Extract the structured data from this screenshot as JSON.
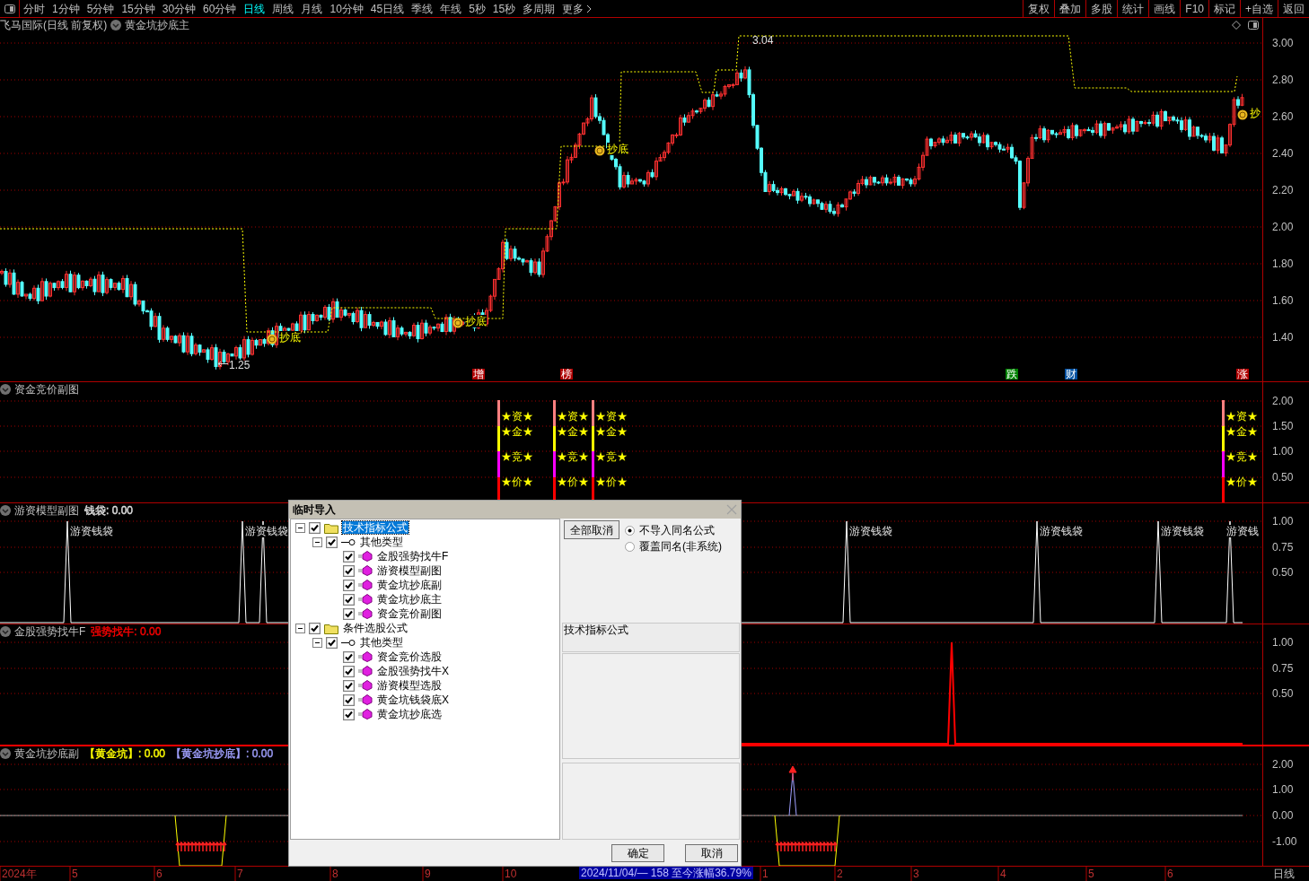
{
  "toolbar": {
    "periods": [
      {
        "label": "分时",
        "selected": false
      },
      {
        "label": "1分钟",
        "selected": false
      },
      {
        "label": "5分钟",
        "selected": false
      },
      {
        "label": "15分钟",
        "selected": false
      },
      {
        "label": "30分钟",
        "selected": false
      },
      {
        "label": "60分钟",
        "selected": false
      },
      {
        "label": "日线",
        "selected": true
      },
      {
        "label": "周线",
        "selected": false
      },
      {
        "label": "月线",
        "selected": false
      },
      {
        "label": "10分钟",
        "selected": false
      },
      {
        "label": "45日线",
        "selected": false
      },
      {
        "label": "季线",
        "selected": false
      },
      {
        "label": "年线",
        "selected": false
      },
      {
        "label": "5秒",
        "selected": false
      },
      {
        "label": "15秒",
        "selected": false
      },
      {
        "label": "多周期",
        "selected": false
      },
      {
        "label": "更多",
        "selected": false
      }
    ],
    "actions": [
      "复权",
      "叠加",
      "多股",
      "统计",
      "画线",
      "F10",
      "标记",
      "+自选",
      "返回"
    ]
  },
  "main_chart": {
    "stock_title": "飞马国际(日线 前复权)",
    "indicator": "黄金坑抄底主",
    "yticks": [
      "3.00",
      "2.80",
      "2.60",
      "2.40",
      "2.20",
      "2.00",
      "1.80",
      "1.60",
      "1.40"
    ],
    "high_label": "3.04",
    "low_label": "1.25",
    "signals": [
      "抄底",
      "抄底",
      "抄底",
      "抄"
    ],
    "event_tags": [
      {
        "label": "增",
        "color": "#b00000"
      },
      {
        "label": "榜",
        "color": "#b00000"
      },
      {
        "label": "跌",
        "color": "#008000"
      },
      {
        "label": "财",
        "color": "#0050a0"
      },
      {
        "label": "涨",
        "color": "#b00000"
      }
    ]
  },
  "panels": [
    {
      "kind": "auction",
      "title": "资金竞价副图",
      "yticks": [
        "2.00",
        "1.50",
        "1.00",
        "0.50"
      ],
      "columns": [
        {
          "labels": [
            "★资★",
            "★金★",
            "★竞★",
            "★价★"
          ]
        },
        {
          "labels": [
            "★资★",
            "★金★",
            "★竞★",
            "★价★"
          ]
        },
        {
          "labels": [
            "★资★",
            "★金★",
            "★竞★",
            "★价★"
          ]
        },
        {
          "labels": [
            "★资★",
            "★金★",
            "★竞★",
            "★价★"
          ]
        }
      ]
    },
    {
      "kind": "peaks",
      "title": "游资模型副图",
      "values": [
        {
          "text": "钱袋: 0.00",
          "color": "#e0e0e0"
        }
      ],
      "yticks": [
        "1.00",
        "0.75",
        "0.50"
      ],
      "peak_labels": [
        "游资钱袋",
        "游资钱袋",
        "游资钱袋",
        "游资钱袋",
        "游资钱袋",
        "游资钱"
      ]
    },
    {
      "kind": "spike",
      "title": "金股强势找牛F",
      "values": [
        {
          "text": "强势找牛: 0.00",
          "color": "#ff0000"
        }
      ],
      "yticks": [
        "1.00",
        "0.75",
        "0.50"
      ]
    },
    {
      "kind": "pit",
      "title": "黄金坑抄底副",
      "values": [
        {
          "text": "【黄金坑】: 0.00",
          "color": "#ffff00"
        },
        {
          "text": "【黄金坑抄底】: 0.00",
          "color": "#a0a0ff"
        }
      ],
      "yticks": [
        "2.00",
        "1.00",
        "0.00",
        "-1.00"
      ]
    }
  ],
  "time_axis": {
    "labels": [
      "2024年",
      "5",
      "6",
      "7",
      "8",
      "9",
      "10",
      "1",
      "2",
      "3",
      "4",
      "5",
      "6"
    ],
    "highlight": "2024/11/04/— 158 至今涨幅36.79%",
    "period": "日线"
  },
  "dialog": {
    "title": "临时导入",
    "tree": [
      {
        "kind": "folder",
        "label": "技术指标公式",
        "checked": true,
        "expanded": true,
        "selected": true,
        "children": [
          {
            "kind": "group",
            "label": "其他类型",
            "checked": true,
            "expanded": true,
            "selected": false,
            "children": [
              {
                "kind": "formula",
                "label": "金股强势找牛F",
                "checked": true,
                "selected": false
              },
              {
                "kind": "formula",
                "label": "游资模型副图",
                "checked": true,
                "selected": false
              },
              {
                "kind": "formula",
                "label": "黄金坑抄底副",
                "checked": true,
                "selected": false
              },
              {
                "kind": "formula",
                "label": "黄金坑抄底主",
                "checked": true,
                "selected": false
              },
              {
                "kind": "formula",
                "label": "资金竞价副图",
                "checked": true,
                "selected": false
              }
            ]
          }
        ]
      },
      {
        "kind": "folder",
        "label": "条件选股公式",
        "checked": true,
        "expanded": true,
        "selected": false,
        "children": [
          {
            "kind": "group",
            "label": "其他类型",
            "checked": true,
            "expanded": true,
            "selected": false,
            "children": [
              {
                "kind": "formula",
                "label": "资金竞价选股",
                "checked": true,
                "selected": false
              },
              {
                "kind": "formula",
                "label": "金股强势找牛X",
                "checked": true,
                "selected": false
              },
              {
                "kind": "formula",
                "label": "游资模型选股",
                "checked": true,
                "selected": false
              },
              {
                "kind": "formula",
                "label": "黄金坑钱袋底X",
                "checked": true,
                "selected": false
              },
              {
                "kind": "formula",
                "label": "黄金坑抄底选",
                "checked": true,
                "selected": false
              }
            ]
          }
        ]
      }
    ],
    "clear_button": "全部取消",
    "options": [
      {
        "label": "不导入同名公式",
        "selected": true
      },
      {
        "label": "覆盖同名(非系统)",
        "selected": false
      }
    ],
    "description_title": "技术指标公式",
    "ok_button": "确定",
    "cancel_button": "取消"
  }
}
